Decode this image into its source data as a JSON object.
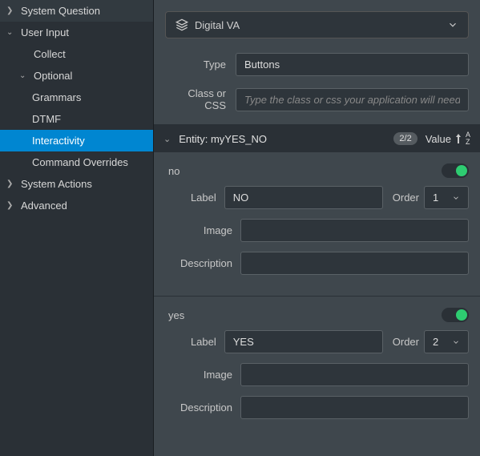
{
  "sidebar": {
    "items": [
      {
        "label": "System Question",
        "chevron": "right",
        "level": 0
      },
      {
        "label": "User Input",
        "chevron": "down",
        "level": 0
      },
      {
        "label": "Collect",
        "chevron": "",
        "level": 1
      },
      {
        "label": "Optional",
        "chevron": "down",
        "level": 1
      },
      {
        "label": "Grammars",
        "chevron": "",
        "level": 2
      },
      {
        "label": "DTMF",
        "chevron": "",
        "level": 2
      },
      {
        "label": "Interactivity",
        "chevron": "",
        "level": 2,
        "selected": true
      },
      {
        "label": "Command Overrides",
        "chevron": "",
        "level": 2
      },
      {
        "label": "System Actions",
        "chevron": "right",
        "level": 0
      },
      {
        "label": "Advanced",
        "chevron": "right",
        "level": 0
      }
    ]
  },
  "channel": {
    "label": "Digital VA"
  },
  "form": {
    "type_label": "Type",
    "type_value": "Buttons",
    "class_label": "Class or CSS",
    "class_placeholder": "Type the class or css your application will need."
  },
  "entity": {
    "title": "Entity: myYES_NO",
    "badge": "2/2",
    "sort_label": "Value",
    "values": [
      {
        "name": "no",
        "label_field": "Label",
        "label_value": "NO",
        "order_label": "Order",
        "order_value": "1",
        "image_label": "Image",
        "image_value": "",
        "desc_label": "Description",
        "desc_value": ""
      },
      {
        "name": "yes",
        "label_field": "Label",
        "label_value": "YES",
        "order_label": "Order",
        "order_value": "2",
        "image_label": "Image",
        "image_value": "",
        "desc_label": "Description",
        "desc_value": ""
      }
    ]
  }
}
